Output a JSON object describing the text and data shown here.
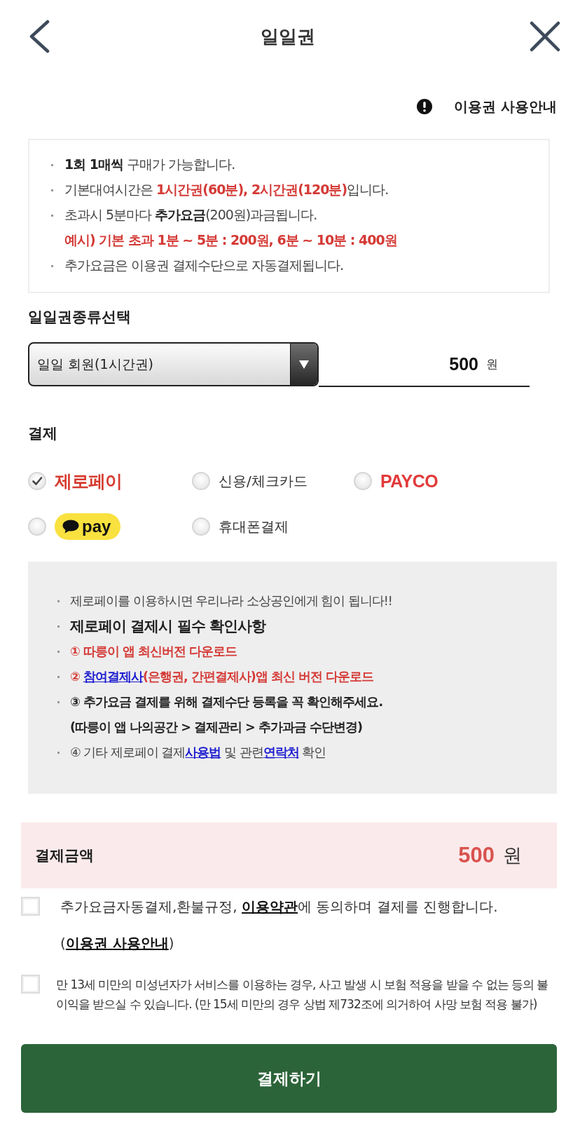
{
  "header": {
    "title": "일일권"
  },
  "guide_link": {
    "label": "이용권 사용안내"
  },
  "notice": [
    {
      "kind": "bullet",
      "segments": [
        {
          "kind": "bold",
          "text": "1회 1매씩"
        },
        {
          "kind": "plain",
          "text": " 구매가 가능합니다."
        }
      ]
    },
    {
      "kind": "bullet",
      "segments": [
        {
          "kind": "plain",
          "text": "기본대여시간은 "
        },
        {
          "kind": "red",
          "text": "1시간권(60분), 2시간권(120분)"
        },
        {
          "kind": "plain",
          "text": "입니다."
        }
      ]
    },
    {
      "kind": "bullet",
      "segments": [
        {
          "kind": "plain",
          "text": "초과시 5분마다 "
        },
        {
          "kind": "bold",
          "text": "추가요금"
        },
        {
          "kind": "plain",
          "text": "(200원)과금됩니다."
        }
      ]
    },
    {
      "kind": "continuation",
      "segments": [
        {
          "kind": "red",
          "text": "예시) 기본 초과 1분 ~ 5분 : 200원, 6분 ~ 10분 : 400원"
        }
      ]
    },
    {
      "kind": "bullet",
      "segments": [
        {
          "kind": "plain",
          "text": "추가요금은 이용권 결제수단으로 자동결제됩니다."
        }
      ]
    }
  ],
  "ticket_type": {
    "label": "일일권종류선택",
    "value": "일일 회원(1시간권)",
    "price": "500",
    "unit": "원"
  },
  "payment": {
    "label": "결제",
    "options": [
      {
        "kind": "brand",
        "label": "제로페이",
        "selected": true
      },
      {
        "kind": "text",
        "label": "신용/체크카드",
        "selected": false
      },
      {
        "kind": "wordmark",
        "label": "PAYCO",
        "selected": false
      },
      {
        "kind": "pill",
        "label": "pay",
        "selected": false
      },
      {
        "kind": "text",
        "label": "휴대폰결제",
        "selected": false
      }
    ]
  },
  "zeropay_info": [
    {
      "kind": "bullet",
      "segments": [
        {
          "kind": "plain",
          "text": "제로페이를 이용하시면 우리나라 소상공인에게 힘이 됩니다!!"
        }
      ]
    },
    {
      "kind": "heading",
      "segments": [
        {
          "kind": "bold",
          "text": "제로페이 결제시 필수 확인사항"
        }
      ]
    },
    {
      "kind": "bullet",
      "segments": [
        {
          "kind": "red",
          "text": "① 따릉이 앱 최신버전 다운로드"
        }
      ]
    },
    {
      "kind": "bullet",
      "segments": [
        {
          "kind": "red",
          "text": "② "
        },
        {
          "kind": "link",
          "text": "참여결제사"
        },
        {
          "kind": "red",
          "text": "(은행권, 간편결제사)앱 최신 버전 다운로드"
        }
      ]
    },
    {
      "kind": "bullet",
      "segments": [
        {
          "kind": "bold",
          "text": "③ 추가요금 결제를 위해 결제수단 등록을 꼭 확인해주세요."
        }
      ]
    },
    {
      "kind": "continuation",
      "segments": [
        {
          "kind": "bold",
          "text": "(따릉이 앱 나의공간 > 결제관리 > 추가과금 수단변경)"
        }
      ]
    },
    {
      "kind": "bullet",
      "segments": [
        {
          "kind": "plain",
          "text": "④ 기타 제로페이 결제"
        },
        {
          "kind": "link",
          "text": "사용법"
        },
        {
          "kind": "plain",
          "text": " 및 관련"
        },
        {
          "kind": "link",
          "text": "연락처"
        },
        {
          "kind": "plain",
          "text": " 확인"
        }
      ]
    }
  ],
  "total": {
    "label": "결제금액",
    "value": "500",
    "unit": "원"
  },
  "agreements": [
    {
      "kind": "terms",
      "checked": false,
      "segments": [
        {
          "kind": "plain",
          "text": "추가요금자동결제,환불규정, "
        },
        {
          "kind": "link",
          "text": "이용약관"
        },
        {
          "kind": "plain",
          "text": "에 동의하며 결제를 진행합니다.("
        },
        {
          "kind": "link",
          "text": "이용권 사용안내"
        },
        {
          "kind": "plain",
          "text": ")"
        }
      ]
    },
    {
      "kind": "warning",
      "checked": false,
      "segments": [
        {
          "kind": "plain",
          "text": "만 13세 미만의 미성년자가 서비스를 이용하는 경우, 사고 발생 시 보험 적용을 받을 수 없는 등의 불이익을 받으실 수 있습니다. (만 15세 미만의 경우 상법 제732조에 의거하여 사망 보험 적용 불가)"
        }
      ]
    }
  ],
  "pay_button": {
    "label": "결제하기"
  }
}
